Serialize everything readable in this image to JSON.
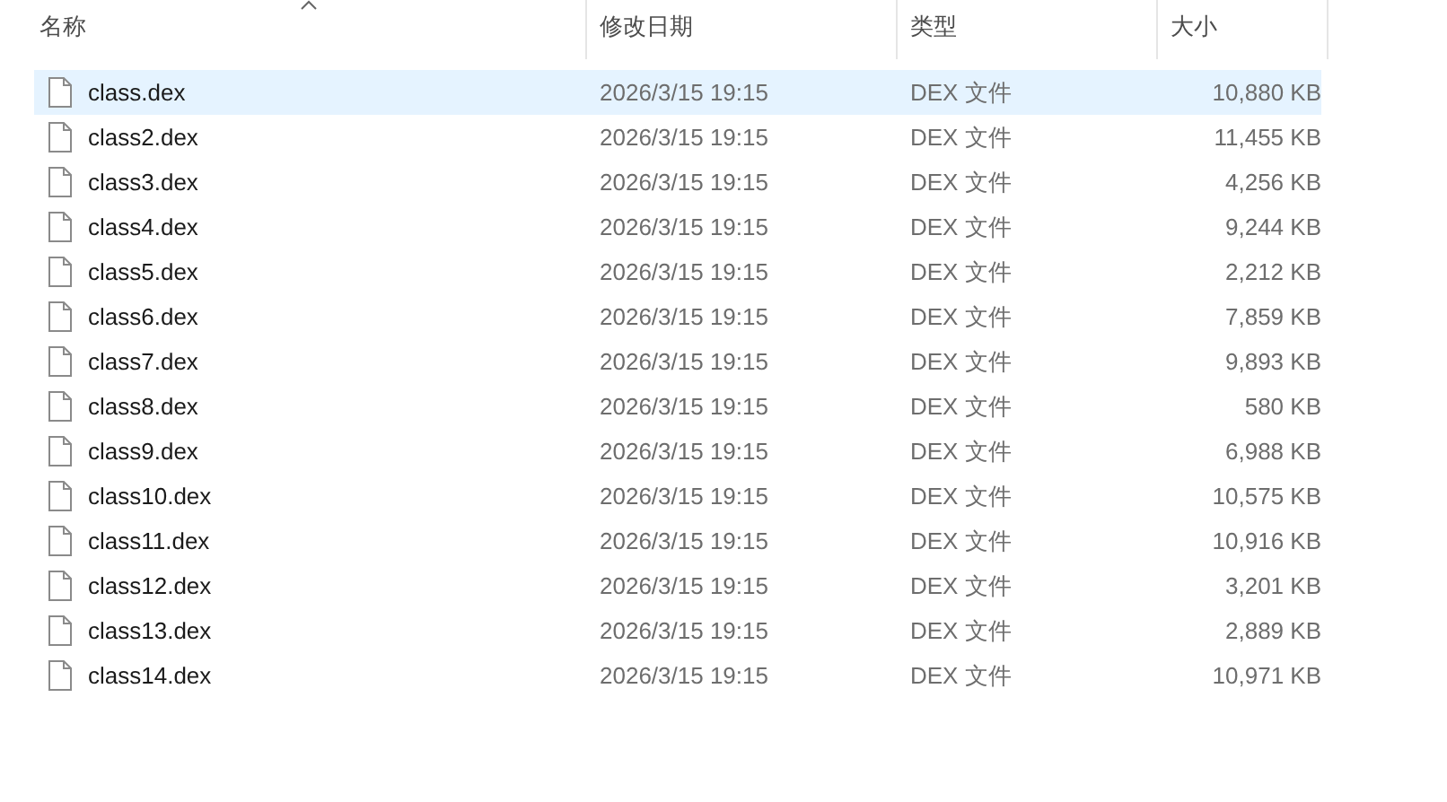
{
  "columns": [
    {
      "label": "名称"
    },
    {
      "label": "修改日期"
    },
    {
      "label": "类型"
    },
    {
      "label": "大小"
    }
  ],
  "rows": [
    {
      "name": "class.dex",
      "date": "2026/3/15 19:15",
      "type": "DEX 文件",
      "size": "10,880 KB",
      "selected": true
    },
    {
      "name": "class2.dex",
      "date": "2026/3/15 19:15",
      "type": "DEX 文件",
      "size": "11,455 KB",
      "selected": false
    },
    {
      "name": "class3.dex",
      "date": "2026/3/15 19:15",
      "type": "DEX 文件",
      "size": "4,256 KB",
      "selected": false
    },
    {
      "name": "class4.dex",
      "date": "2026/3/15 19:15",
      "type": "DEX 文件",
      "size": "9,244 KB",
      "selected": false
    },
    {
      "name": "class5.dex",
      "date": "2026/3/15 19:15",
      "type": "DEX 文件",
      "size": "2,212 KB",
      "selected": false
    },
    {
      "name": "class6.dex",
      "date": "2026/3/15 19:15",
      "type": "DEX 文件",
      "size": "7,859 KB",
      "selected": false
    },
    {
      "name": "class7.dex",
      "date": "2026/3/15 19:15",
      "type": "DEX 文件",
      "size": "9,893 KB",
      "selected": false
    },
    {
      "name": "class8.dex",
      "date": "2026/3/15 19:15",
      "type": "DEX 文件",
      "size": "580 KB",
      "selected": false
    },
    {
      "name": "class9.dex",
      "date": "2026/3/15 19:15",
      "type": "DEX 文件",
      "size": "6,988 KB",
      "selected": false
    },
    {
      "name": "class10.dex",
      "date": "2026/3/15 19:15",
      "type": "DEX 文件",
      "size": "10,575 KB",
      "selected": false
    },
    {
      "name": "class11.dex",
      "date": "2026/3/15 19:15",
      "type": "DEX 文件",
      "size": "10,916 KB",
      "selected": false
    },
    {
      "name": "class12.dex",
      "date": "2026/3/15 19:15",
      "type": "DEX 文件",
      "size": "3,201 KB",
      "selected": false
    },
    {
      "name": "class13.dex",
      "date": "2026/3/15 19:15",
      "type": "DEX 文件",
      "size": "2,889 KB",
      "selected": false
    },
    {
      "name": "class14.dex",
      "date": "2026/3/15 19:15",
      "type": "DEX 文件",
      "size": "10,971 KB",
      "selected": false
    }
  ]
}
